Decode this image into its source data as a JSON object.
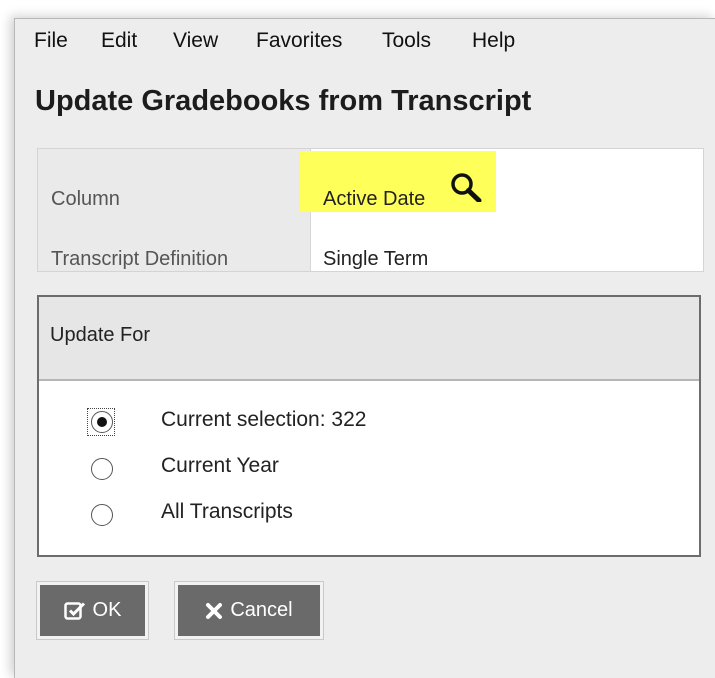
{
  "menu": [
    {
      "label": "File"
    },
    {
      "label": "Edit"
    },
    {
      "label": "View"
    },
    {
      "label": "Favorites"
    },
    {
      "label": "Tools"
    },
    {
      "label": "Help"
    }
  ],
  "dialog": {
    "title": "Update Gradebooks from Transcript"
  },
  "fields": {
    "column": {
      "label": "Column",
      "value": "Active Date"
    },
    "transcript_definition": {
      "label": "Transcript Definition",
      "value": "Single Term"
    }
  },
  "update_for": {
    "title": "Update For",
    "options": [
      {
        "label": "Current selection: 322",
        "selected": true
      },
      {
        "label": "Current Year",
        "selected": false
      },
      {
        "label": "All Transcripts",
        "selected": false
      }
    ]
  },
  "buttons": {
    "ok": {
      "label": "OK",
      "icon": "checkbox-check-icon"
    },
    "cancel": {
      "label": "Cancel",
      "icon": "close-icon"
    }
  },
  "colors": {
    "highlight": "#ffff5a",
    "button_bg": "#6a6a6a",
    "header_bg": "#e6e6e6"
  }
}
